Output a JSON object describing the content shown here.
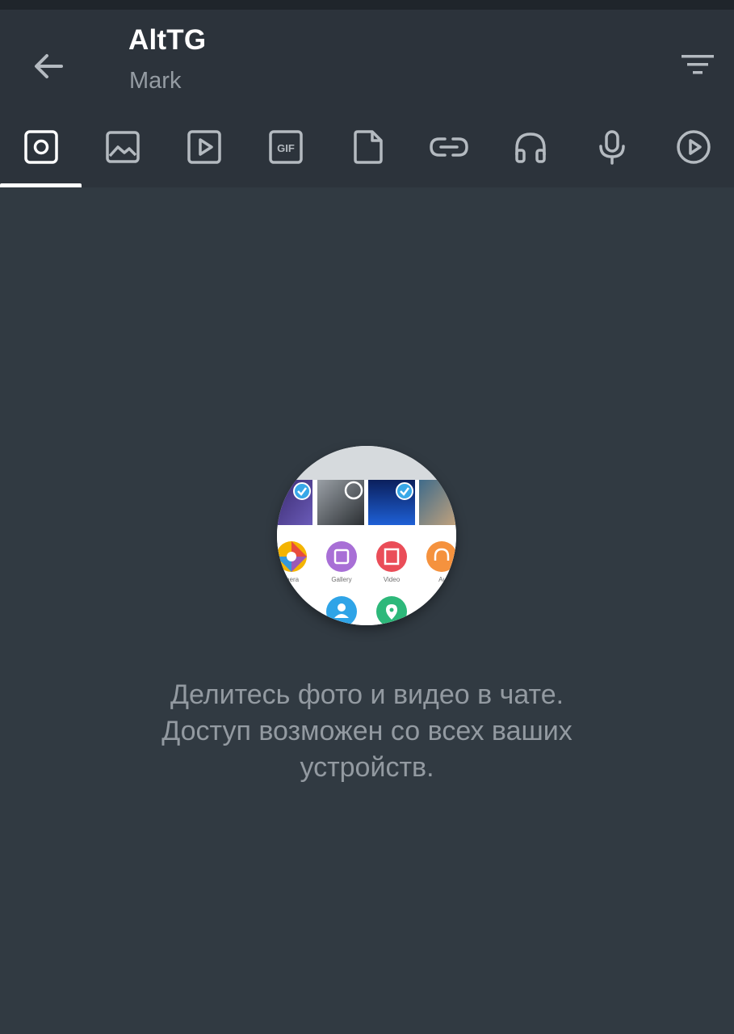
{
  "header": {
    "title": "AltTG",
    "subtitle": "Mark"
  },
  "tabs": [
    {
      "icon": "camera-square-icon",
      "active": true
    },
    {
      "icon": "image-icon",
      "active": false
    },
    {
      "icon": "video-icon",
      "active": false
    },
    {
      "icon": "gif-icon",
      "active": false
    },
    {
      "icon": "document-icon",
      "active": false
    },
    {
      "icon": "link-icon",
      "active": false
    },
    {
      "icon": "headphones-icon",
      "active": false
    },
    {
      "icon": "microphone-icon",
      "active": false
    },
    {
      "icon": "round-video-icon",
      "active": false
    }
  ],
  "gif_label": "GIF",
  "illustration": {
    "attach_labels": [
      "mera",
      "Gallery",
      "Video",
      "Au"
    ]
  },
  "empty_state": {
    "line1": "Делитесь фото и видео в чате.",
    "line2": "Доступ возможен со всех ваших",
    "line3": "устройств."
  },
  "colors": {
    "appbar": "#2c333b",
    "background": "#313a42",
    "title": "#ffffff",
    "subtitle": "#959ca3",
    "icon": "#b4bac0"
  }
}
